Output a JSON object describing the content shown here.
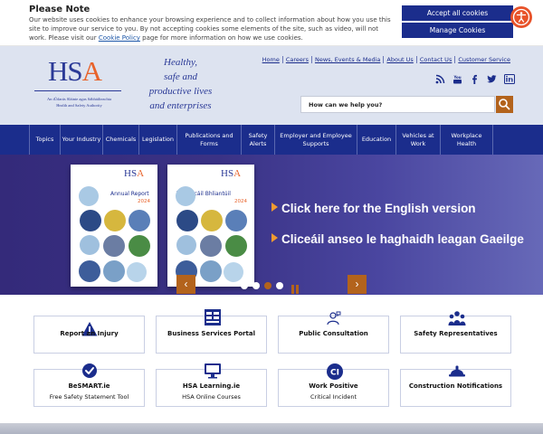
{
  "cookie": {
    "title": "Please Note",
    "text_before": "Our website uses cookies to enhance your browsing experience and to collect information about how you use this site to improve our service to you. By not accepting cookies some elements of the site, such as video, will not work. Please visit our ",
    "policy_link": "Cookie Policy",
    "text_after": " page for more information on how we use cookies.",
    "accept_label": "Accept all cookies",
    "manage_label": "Manage Cookies"
  },
  "header": {
    "logo_text_a": "HS",
    "logo_text_b": "A",
    "logo_irish": "An tÚdarás Sláinte agus Sábháilteachta",
    "logo_english": "Health and Safety Authority",
    "tagline": [
      "Healthy,",
      "safe and",
      "productive lives",
      "and enterprises"
    ],
    "top_links": [
      "Home",
      "Careers",
      "News, Events & Media",
      "About Us",
      "Contact Us",
      "Customer Service"
    ],
    "social_icons": [
      "rss-icon",
      "youtube-icon",
      "facebook-icon",
      "twitter-icon",
      "linkedin-icon"
    ],
    "search_placeholder": "How can we help you?"
  },
  "nav": [
    "Topics",
    "Your Industry",
    "Chemicals",
    "Legislation",
    "Publications and Forms",
    "Safety Alerts",
    "Employer and Employee Supports",
    "Education",
    "Vehicles at Work",
    "Workplace Health"
  ],
  "hero": {
    "covers": [
      {
        "title": "Annual Report",
        "year": "2024"
      },
      {
        "title": "Tuarascáil Bhliantúil",
        "year": "2024"
      }
    ],
    "link_english": "Click here for the English version",
    "link_irish": "Cliceáil anseo le haghaidh leagan Gaeilge",
    "prev_label": "‹",
    "next_label": "›",
    "active_slide": 3,
    "slide_count": 4
  },
  "quick_links": [
    {
      "icon": "warning-triangle-icon",
      "line1": "Report an Injury",
      "line2": ""
    },
    {
      "icon": "services-portal-icon",
      "line1": "Business Services Portal",
      "line2": ""
    },
    {
      "icon": "consultation-person-icon",
      "line1": "Public Consultation",
      "line2": ""
    },
    {
      "icon": "people-group-icon",
      "line1": "Safety Representatives",
      "line2": ""
    },
    {
      "icon": "check-badge-icon",
      "line1": "BeSMART.ie",
      "line2": "Free Safety Statement Tool"
    },
    {
      "icon": "monitor-icon",
      "line1": "HSA Learning.ie",
      "line2": "HSA Online Courses"
    },
    {
      "icon": "ci-badge-icon",
      "line1": "Work Positive",
      "line2": "Critical Incident"
    },
    {
      "icon": "hard-hat-icon",
      "line1": "Construction Notifications",
      "line2": ""
    }
  ],
  "colors": {
    "brand_navy": "#1b2d8c",
    "brand_orange": "#e8632b",
    "button_brown": "#b3631c"
  }
}
